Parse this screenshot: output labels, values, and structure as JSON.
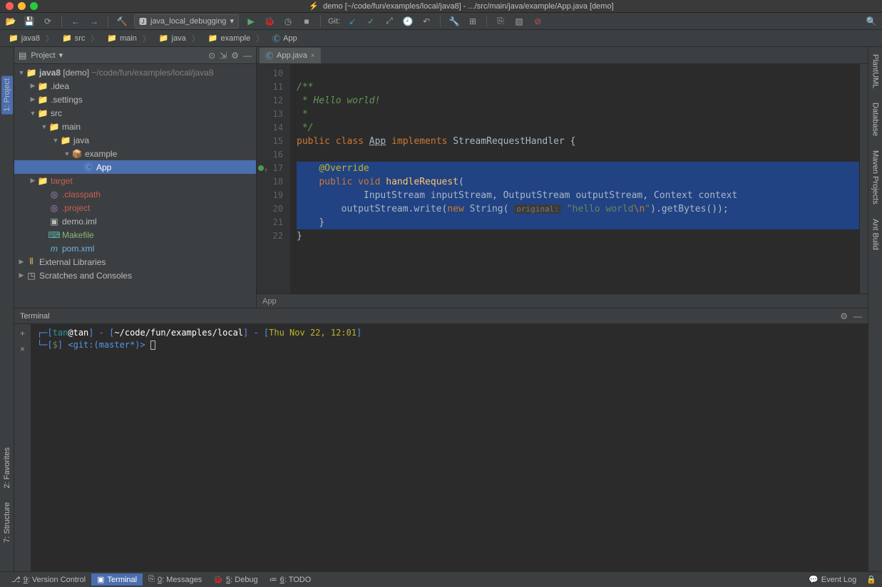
{
  "title": "demo [~/code/fun/examples/local/java8] - .../src/main/java/example/App.java [demo]",
  "runconfig": "java_local_debugging",
  "git_label": "Git:",
  "breadcrumbs": [
    {
      "icon": "folder",
      "label": "java8"
    },
    {
      "icon": "folder",
      "label": "src"
    },
    {
      "icon": "folder",
      "label": "main"
    },
    {
      "icon": "folder",
      "label": "java"
    },
    {
      "icon": "folder",
      "label": "example"
    },
    {
      "icon": "class",
      "label": "App"
    }
  ],
  "project_label": "Project",
  "sidebar_tabs": {
    "project": "1: Project",
    "favorites": "2: Favorites",
    "structure": "7: Structure"
  },
  "right_tabs": {
    "plantuml": "PlantUML",
    "database": "Database",
    "maven": "Maven Projects",
    "ant": "Ant Build"
  },
  "tree": {
    "root": {
      "name": "java8",
      "tag": "[demo]",
      "path": "~/code/fun/examples/local/java8"
    },
    "idea": ".idea",
    "settings": ".settings",
    "src": "src",
    "main": "main",
    "java": "java",
    "example": "example",
    "app": "App",
    "target": "target",
    "classpath": ".classpath",
    "project": ".project",
    "demo_iml": "demo.iml",
    "makefile": "Makefile",
    "pom": "pom.xml",
    "extlib": "External Libraries",
    "scratch": "Scratches and Consoles"
  },
  "editor": {
    "tab_label": "App.java",
    "crumb": "App",
    "lines": {
      "l10": "/**",
      "l11": " * Hello world!",
      "l12": " *",
      "l13": " */"
    },
    "code": {
      "class_name": "App",
      "iface": "StreamRequestHandler",
      "override": "@Override",
      "method": "handleRequest",
      "istream_type": "InputStream",
      "istream_name": "inputStream",
      "ostream_type": "OutputStream",
      "ostream_name": "outputStream",
      "ctx_type": "Context",
      "ctx_name": "context",
      "ostream_var": "outputStream",
      "write": "write",
      "new_kw": "new",
      "string_cls": "String",
      "hint": "original:",
      "str_val": "\"hello world",
      "str_esc": "\\n",
      "str_end": "\"",
      "get_bytes": "getBytes",
      "public": "public",
      "void": "void",
      "class_kw": "class",
      "implements": "implements"
    },
    "line_numbers": [
      10,
      11,
      12,
      13,
      14,
      15,
      16,
      17,
      18,
      19,
      20,
      21,
      22
    ]
  },
  "terminal": {
    "title": "Terminal",
    "line1": {
      "user": "tan",
      "at_host": "@tan",
      "path": "~/code/fun/examples/local",
      "date": "Thu Nov 22, 12:01"
    },
    "line2": {
      "prompt": "$",
      "git": "<git:(master*)>"
    }
  },
  "status": {
    "vcs": "9: Version Control",
    "term": "Terminal",
    "msg": "0: Messages",
    "dbg": "5: Debug",
    "todo": "6: TODO",
    "log": "Event Log"
  }
}
